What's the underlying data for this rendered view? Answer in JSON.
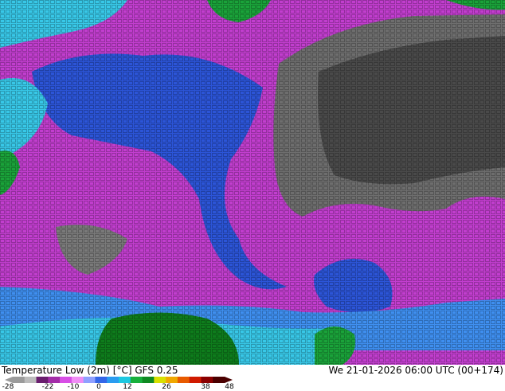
{
  "map": {
    "field_name": "Temperature Low (2m) [°C]",
    "model": "GFS 0.25",
    "valid_time": "We 21-01-2026 06:00 UTC (00+174)",
    "colors": {
      "deep_cold": "#4a4a4a",
      "cold_grey": "#6e6e6e",
      "very_cold_maroon": "#8a3a7a",
      "cold_magenta": "#c23ecf",
      "cold_pink": "#e36ef0",
      "cool_blue": "#2c55d8",
      "light_blue": "#3f8ff0",
      "cyan": "#38c8e8",
      "mild_green": "#1aa33a",
      "warm_green": "#0e7d1c"
    }
  },
  "legend": {
    "ticks": [
      "-28",
      "-22",
      "-10",
      "0",
      "12",
      "26",
      "38",
      "48"
    ],
    "colors": [
      "#9b9b9b",
      "#bcbcbc",
      "#6a1e6e",
      "#a32da8",
      "#d84ee6",
      "#f08cf5",
      "#8fa0ff",
      "#3466e8",
      "#2a9cf0",
      "#1ec8e0",
      "#18b03c",
      "#0f8a22",
      "#d8e000",
      "#f0a800",
      "#e85a00",
      "#d01a00",
      "#8b0000",
      "#4a0000"
    ]
  }
}
